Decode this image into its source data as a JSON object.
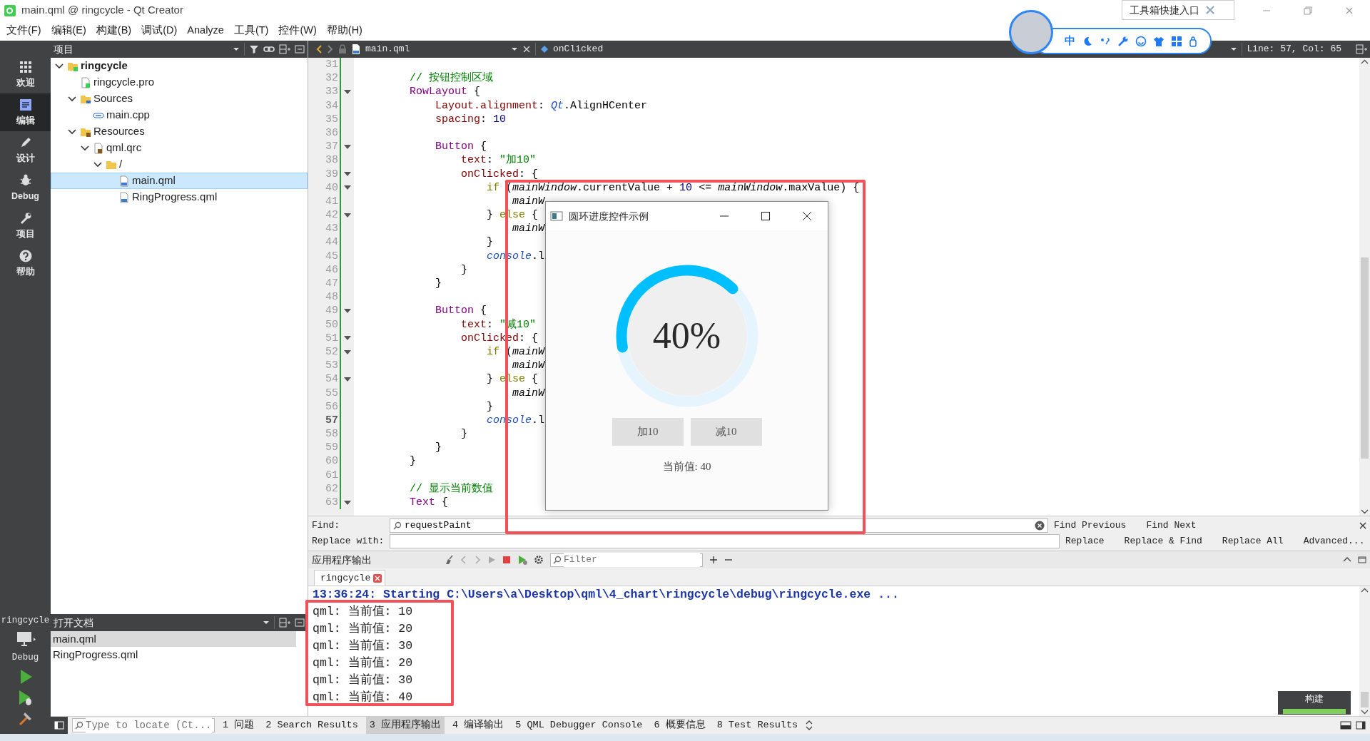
{
  "window": {
    "title": "main.qml @ ringcycle - Qt Creator"
  },
  "menu": [
    "文件(F)",
    "编辑(E)",
    "构建(B)",
    "调试(D)",
    "Analyze",
    "工具(T)",
    "控件(W)",
    "帮助(H)"
  ],
  "mode_bar": {
    "items": [
      {
        "label": "欢迎",
        "selected": false
      },
      {
        "label": "编辑",
        "selected": true
      },
      {
        "label": "设计",
        "selected": false
      },
      {
        "label": "Debug",
        "selected": false
      },
      {
        "label": "项目",
        "selected": false
      },
      {
        "label": "帮助",
        "selected": false
      }
    ],
    "kit": {
      "project": "ringcycle",
      "build": "Debug"
    }
  },
  "project_panel": {
    "title": "项目",
    "tree": [
      {
        "label": "ringcycle",
        "kind": "project",
        "expanded": true,
        "selected": false,
        "children": [
          {
            "label": "ringcycle.pro",
            "kind": "pro",
            "selected": false
          },
          {
            "label": "Sources",
            "kind": "sources",
            "expanded": true,
            "selected": false,
            "children": [
              {
                "label": "main.cpp",
                "kind": "cpp",
                "selected": false
              }
            ]
          },
          {
            "label": "Resources",
            "kind": "resources",
            "expanded": true,
            "selected": false,
            "children": [
              {
                "label": "qml.qrc",
                "kind": "qrc",
                "expanded": true,
                "selected": false,
                "children": [
                  {
                    "label": "/",
                    "kind": "folder",
                    "expanded": true,
                    "selected": false,
                    "children": [
                      {
                        "label": "main.qml",
                        "kind": "qml",
                        "selected": true
                      },
                      {
                        "label": "RingProgress.qml",
                        "kind": "qml",
                        "selected": false
                      }
                    ]
                  }
                ]
              }
            ]
          }
        ]
      }
    ]
  },
  "open_documents": {
    "title": "打开文档",
    "items": [
      {
        "label": "main.qml",
        "selected": true
      },
      {
        "label": "RingProgress.qml",
        "selected": false
      }
    ]
  },
  "editor": {
    "file": "main.qml",
    "symbol": "onClicked",
    "position": "Line: 57, Col: 65",
    "lines": [
      {
        "number": "31",
        "current": false,
        "foldable": false
      },
      {
        "number": "32",
        "current": false,
        "foldable": false,
        "tokens": [
          {
            "text": "        // 按钮控制区域",
            "kind": "comment"
          }
        ]
      },
      {
        "number": "33",
        "current": false,
        "foldable": true,
        "tokens": [
          {
            "text": "        RowLayout",
            "kind": "type"
          },
          {
            "text": " {",
            "kind": "plain"
          }
        ]
      },
      {
        "number": "34",
        "current": false,
        "foldable": false,
        "tokens": [
          {
            "text": "            Layout.alignment",
            "kind": "property"
          },
          {
            "text": ": ",
            "kind": "plain"
          },
          {
            "text": "Qt",
            "kind": "builtin"
          },
          {
            "text": ".AlignHCenter",
            "kind": "plain"
          }
        ]
      },
      {
        "number": "35",
        "current": false,
        "foldable": false,
        "tokens": [
          {
            "text": "            spacing",
            "kind": "property"
          },
          {
            "text": ": ",
            "kind": "plain"
          },
          {
            "text": "10",
            "kind": "number"
          }
        ]
      },
      {
        "number": "36",
        "current": false,
        "foldable": false
      },
      {
        "number": "37",
        "current": false,
        "foldable": true,
        "tokens": [
          {
            "text": "            Button",
            "kind": "type"
          },
          {
            "text": " {",
            "kind": "plain"
          }
        ]
      },
      {
        "number": "38",
        "current": false,
        "foldable": false,
        "tokens": [
          {
            "text": "                text",
            "kind": "property"
          },
          {
            "text": ": ",
            "kind": "plain"
          },
          {
            "text": "\"加10\"",
            "kind": "string"
          }
        ]
      },
      {
        "number": "39",
        "current": false,
        "foldable": true,
        "tokens": [
          {
            "text": "                onClicked",
            "kind": "property"
          },
          {
            "text": ": {",
            "kind": "plain"
          }
        ]
      },
      {
        "number": "40",
        "current": false,
        "foldable": true,
        "tokens": [
          {
            "text": "                    if",
            "kind": "keyword"
          },
          {
            "text": " (",
            "kind": "plain"
          },
          {
            "text": "mainWindow",
            "kind": "object"
          },
          {
            "text": ".currentValue + ",
            "kind": "plain"
          },
          {
            "text": "10",
            "kind": "number"
          },
          {
            "text": " <= ",
            "kind": "plain"
          },
          {
            "text": "mainWindow",
            "kind": "object"
          },
          {
            "text": ".maxValue) {",
            "kind": "plain"
          }
        ]
      },
      {
        "number": "41",
        "current": false,
        "foldable": false,
        "tokens": [
          {
            "text": "                        mainW",
            "kind": "object"
          }
        ]
      },
      {
        "number": "42",
        "current": false,
        "foldable": true,
        "tokens": [
          {
            "text": "                    } ",
            "kind": "plain"
          },
          {
            "text": "else",
            "kind": "keyword"
          },
          {
            "text": " {",
            "kind": "plain"
          }
        ]
      },
      {
        "number": "43",
        "current": false,
        "foldable": false,
        "tokens": [
          {
            "text": "                        mainW",
            "kind": "object"
          }
        ]
      },
      {
        "number": "44",
        "current": false,
        "foldable": false,
        "tokens": [
          {
            "text": "                    }",
            "kind": "plain"
          }
        ]
      },
      {
        "number": "45",
        "current": false,
        "foldable": false,
        "tokens": [
          {
            "text": "                    console",
            "kind": "builtin"
          },
          {
            "text": ".l",
            "kind": "plain"
          }
        ]
      },
      {
        "number": "46",
        "current": false,
        "foldable": false,
        "tokens": [
          {
            "text": "                }",
            "kind": "plain"
          }
        ]
      },
      {
        "number": "47",
        "current": false,
        "foldable": false,
        "tokens": [
          {
            "text": "            }",
            "kind": "plain"
          }
        ]
      },
      {
        "number": "48",
        "current": false,
        "foldable": false
      },
      {
        "number": "49",
        "current": false,
        "foldable": true,
        "tokens": [
          {
            "text": "            Button",
            "kind": "type"
          },
          {
            "text": " {",
            "kind": "plain"
          }
        ]
      },
      {
        "number": "50",
        "current": false,
        "foldable": false,
        "tokens": [
          {
            "text": "                text",
            "kind": "property"
          },
          {
            "text": ": ",
            "kind": "plain"
          },
          {
            "text": "\"减10\"",
            "kind": "string"
          }
        ]
      },
      {
        "number": "51",
        "current": false,
        "foldable": true,
        "tokens": [
          {
            "text": "                onClicked",
            "kind": "property"
          },
          {
            "text": ": {",
            "kind": "plain"
          }
        ]
      },
      {
        "number": "52",
        "current": false,
        "foldable": true,
        "tokens": [
          {
            "text": "                    if",
            "kind": "keyword"
          },
          {
            "text": " (",
            "kind": "plain"
          },
          {
            "text": "mainW",
            "kind": "object"
          }
        ]
      },
      {
        "number": "53",
        "current": false,
        "foldable": false,
        "tokens": [
          {
            "text": "                        mainW",
            "kind": "object"
          }
        ]
      },
      {
        "number": "54",
        "current": false,
        "foldable": true,
        "tokens": [
          {
            "text": "                    } ",
            "kind": "plain"
          },
          {
            "text": "else",
            "kind": "keyword"
          },
          {
            "text": " {",
            "kind": "plain"
          }
        ]
      },
      {
        "number": "55",
        "current": false,
        "foldable": false,
        "tokens": [
          {
            "text": "                        mainW",
            "kind": "object"
          }
        ]
      },
      {
        "number": "56",
        "current": false,
        "foldable": false,
        "tokens": [
          {
            "text": "                    }",
            "kind": "plain"
          }
        ]
      },
      {
        "number": "57",
        "current": true,
        "foldable": false,
        "tokens": [
          {
            "text": "                    console",
            "kind": "builtin"
          },
          {
            "text": ".l",
            "kind": "plain"
          }
        ]
      },
      {
        "number": "58",
        "current": false,
        "foldable": false,
        "tokens": [
          {
            "text": "                }",
            "kind": "plain"
          }
        ]
      },
      {
        "number": "59",
        "current": false,
        "foldable": false,
        "tokens": [
          {
            "text": "            }",
            "kind": "plain"
          }
        ]
      },
      {
        "number": "60",
        "current": false,
        "foldable": false,
        "tokens": [
          {
            "text": "        }",
            "kind": "plain"
          }
        ]
      },
      {
        "number": "61",
        "current": false,
        "foldable": false
      },
      {
        "number": "62",
        "current": false,
        "foldable": false,
        "tokens": [
          {
            "text": "        // 显示当前数值",
            "kind": "comment"
          }
        ]
      },
      {
        "number": "63",
        "current": false,
        "foldable": true,
        "tokens": [
          {
            "text": "        Text",
            "kind": "type"
          },
          {
            "text": " {",
            "kind": "plain"
          }
        ]
      }
    ]
  },
  "dialog": {
    "title": "圆环进度控件示例",
    "level": 0.4,
    "percent": "40%",
    "buttons": [
      "加10",
      "减10"
    ],
    "value_text": "当前值: 40"
  },
  "find_bar": {
    "find_label": "Find:",
    "find_value": "requestPaint",
    "replace_label": "Replace with:",
    "find_actions": [
      "Find Previous",
      "Find Next"
    ],
    "replace_actions": [
      "Replace",
      "Replace & Find",
      "Replace All",
      "Advanced..."
    ]
  },
  "output_pane": {
    "title": "应用程序输出",
    "filter": {
      "placeholder": "Filter"
    },
    "tabs": [
      {
        "label": "ringcycle",
        "selected": true
      }
    ],
    "lines": [
      {
        "text": "13:36:24: Starting C:\\Users\\a\\Desktop\\qml\\4_chart\\ringcycle\\debug\\ringcycle.exe ...",
        "kind": "status"
      },
      {
        "text": "qml: 当前值: 10",
        "kind": "debug"
      },
      {
        "text": "qml: 当前值: 20",
        "kind": "debug"
      },
      {
        "text": "qml: 当前值: 30",
        "kind": "debug"
      },
      {
        "text": "qml: 当前值: 20",
        "kind": "debug"
      },
      {
        "text": "qml: 当前值: 30",
        "kind": "debug"
      },
      {
        "text": "qml: 当前值: 40",
        "kind": "debug"
      }
    ],
    "build": {
      "label": "构建",
      "level": 1
    }
  },
  "status_bar": {
    "locate": {
      "placeholder": "Type to locate (Ct..."
    },
    "tabs": [
      {
        "label": "1 问题",
        "selected": false
      },
      {
        "label": "2 Search Results",
        "selected": false
      },
      {
        "label": "3 应用程序输出",
        "selected": true
      },
      {
        "label": "4 编译输出",
        "selected": false
      },
      {
        "label": "5 QML Debugger Console",
        "selected": false
      },
      {
        "label": "6 概要信息",
        "selected": false
      },
      {
        "label": "8 Test Results",
        "selected": false
      }
    ]
  },
  "ime_toolbar": {
    "mode": "中",
    "tooltip": "工具箱快捷入口"
  }
}
